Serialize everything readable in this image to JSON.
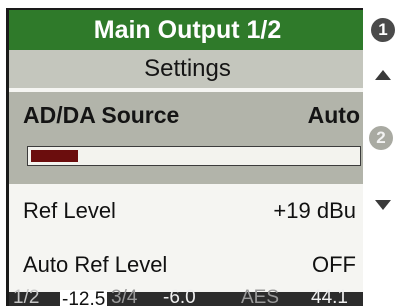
{
  "title": "Main Output 1/2",
  "section": "Settings",
  "source": {
    "label": "AD/DA Source",
    "value": "Auto",
    "level_fraction": 0.15,
    "level_color": "#6b0d0d"
  },
  "rows": [
    {
      "label": "Ref Level",
      "value": "+19 dBu"
    },
    {
      "label": "Auto Ref Level",
      "value": "OFF"
    }
  ],
  "status": {
    "ch12": "1/2",
    "val12": "-12.5",
    "ch34": "3/4",
    "val34": "-6.0",
    "aes": "AES",
    "rate": "44.1"
  },
  "badges": {
    "one": "1",
    "two": "2"
  },
  "icons": {
    "scroll_up": "triangle-up-icon",
    "dropdown": "triangle-down-icon"
  },
  "colors": {
    "title_bg": "#2f7a2a",
    "section_bg": "#c4c6bd",
    "panel_bg": "#b2b4aa",
    "status_bg": "#2c2c2c"
  }
}
